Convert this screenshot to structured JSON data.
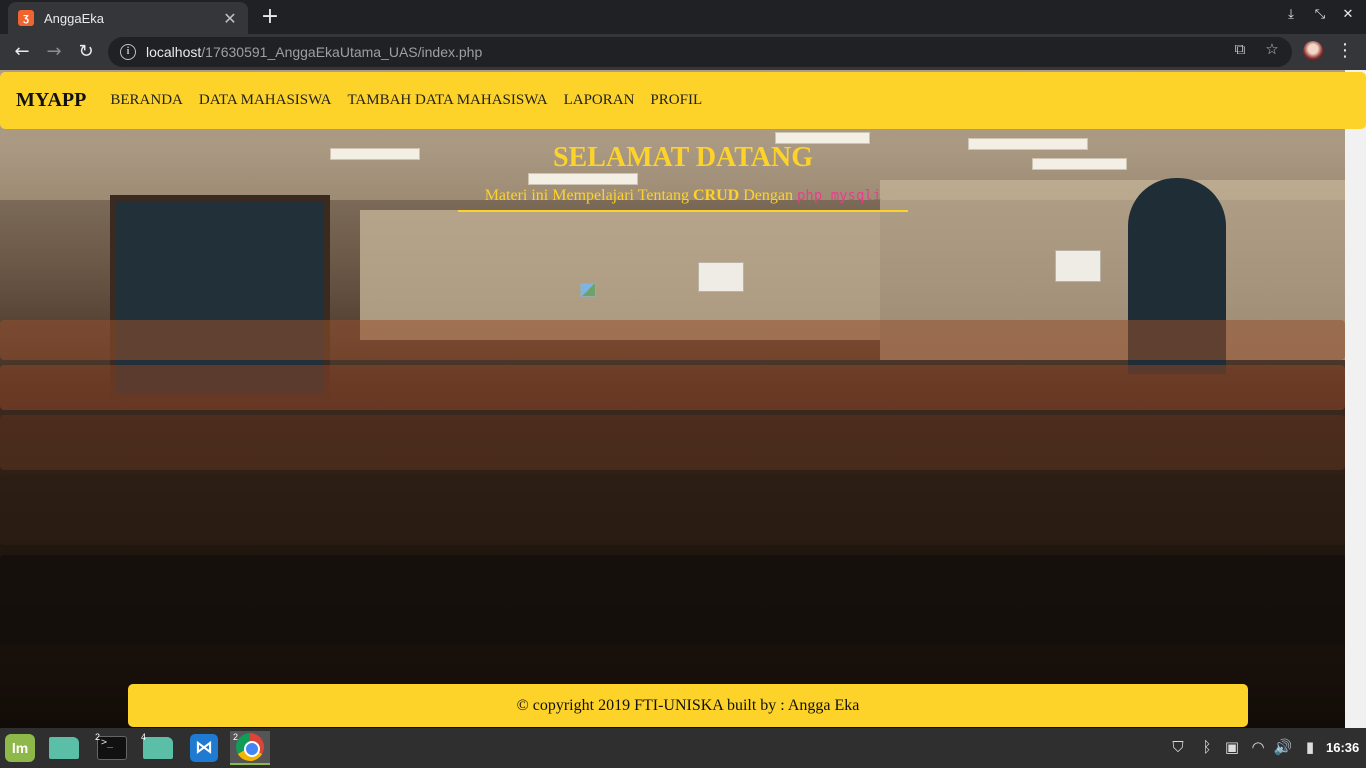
{
  "browser": {
    "tab_title": "AnggaEka",
    "tab_favicon": "xampp-icon",
    "url_host": "localhost",
    "url_path": "/17630591_AnggaEkaUtama_UAS/index.php"
  },
  "navbar": {
    "brand": "MYAPP",
    "links": [
      "BERANDA",
      "DATA MAHASISWA",
      "TAMBAH DATA MAHASISWA",
      "LAPORAN",
      "PROFIL"
    ]
  },
  "hero": {
    "title": "SELAMAT DATANG",
    "subtitle_prefix": "Materi ini Mempelajari Tentang",
    "subtitle_bold": "CRUD",
    "subtitle_middle": "Dengan",
    "subtitle_code": "php mysqli"
  },
  "footer": {
    "text": "© copyright 2019 FTI-UNISKA built by : Angga Eka"
  },
  "taskbar": {
    "terminal_badge": "2",
    "files_badge": "4",
    "chrome_badge": "2",
    "clock": "16:36"
  },
  "colors": {
    "accent_yellow": "#fdd32a",
    "code_pink": "#e83e8c",
    "chrome_dark": "#202124",
    "chrome_toolbar": "#35363a"
  }
}
